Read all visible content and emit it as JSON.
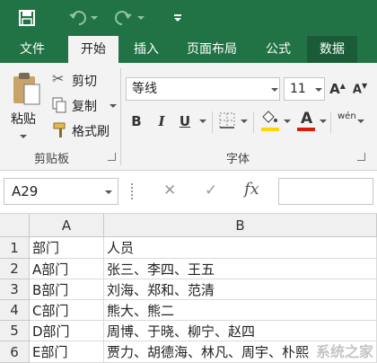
{
  "colors": {
    "brand": "#217346",
    "ribbon_bg": "#f3f3f3",
    "font_color_bar": "#d81e06",
    "highlight_bar": "#ffd700"
  },
  "quick_access": {
    "save_icon": "save-icon",
    "undo_icon": "undo-icon",
    "redo_icon": "redo-icon",
    "customize_icon": "customize-icon"
  },
  "tabs": [
    {
      "label": "文件"
    },
    {
      "label": "开始"
    },
    {
      "label": "插入"
    },
    {
      "label": "页面布局"
    },
    {
      "label": "公式"
    },
    {
      "label": "数据"
    }
  ],
  "ribbon": {
    "clipboard": {
      "paste_label": "粘贴",
      "cut_label": "剪切",
      "copy_label": "复制",
      "format_painter_label": "格式刷",
      "group_label": "剪贴板"
    },
    "font": {
      "font_name": "等线",
      "font_size": "11",
      "bold": "B",
      "italic": "I",
      "underline": "U",
      "font_color_glyph": "A",
      "phonetic_glyph": "wén",
      "group_label": "字体"
    }
  },
  "formula_bar": {
    "name_box": "A29",
    "cancel": "✕",
    "enter": "✓",
    "fx": "fx",
    "value": ""
  },
  "sheet": {
    "columns": [
      "A",
      "B"
    ],
    "rows": [
      {
        "num": "1",
        "a": "部门",
        "b": "人员"
      },
      {
        "num": "2",
        "a": "A部门",
        "b": "张三、李四、王五"
      },
      {
        "num": "3",
        "a": "B部门",
        "b": "刘海、郑和、范清"
      },
      {
        "num": "4",
        "a": "C部门",
        "b": "熊大、熊二"
      },
      {
        "num": "5",
        "a": "D部门",
        "b": "周博、于晓、柳宁、赵四"
      },
      {
        "num": "6",
        "a": "E部门",
        "b": "贾力、胡德海、林凡、周宇、朴熙"
      }
    ]
  },
  "watermark": "系统之家"
}
